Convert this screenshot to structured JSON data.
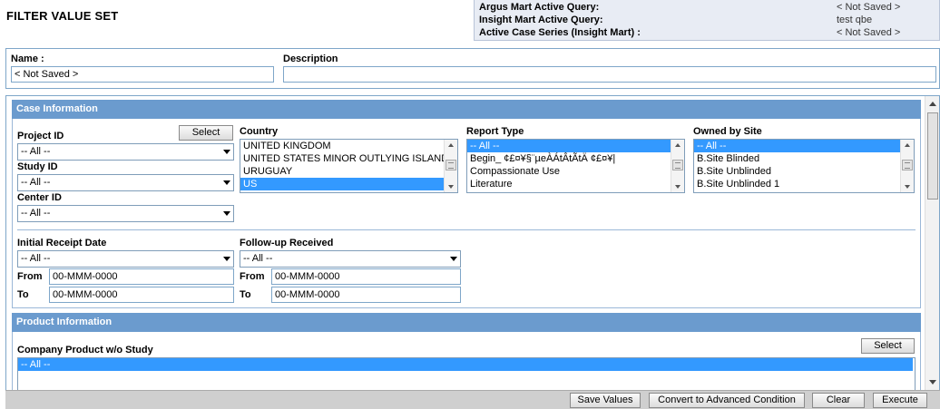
{
  "page_title": "FILTER VALUE SET",
  "active_queries": [
    {
      "label": "Argus Mart Active Query:",
      "value": "< Not Saved >"
    },
    {
      "label": "Insight Mart Active Query:",
      "value": "test qbe"
    },
    {
      "label": "Active Case Series (Insight Mart) :",
      "value": "< Not Saved >"
    }
  ],
  "name_section": {
    "name_label": "Name :",
    "name_value": "< Not Saved >",
    "description_label": "Description",
    "description_value": ""
  },
  "case_info": {
    "header": "Case Information",
    "select_label": "Select",
    "project_id": {
      "label": "Project ID",
      "value": "-- All --"
    },
    "study_id": {
      "label": "Study ID",
      "value": "-- All --"
    },
    "center_id": {
      "label": "Center ID",
      "value": "-- All --"
    },
    "country": {
      "label": "Country",
      "items": [
        "UNITED KINGDOM",
        "UNITED STATES MINOR OUTLYING ISLANDS",
        "URUGUAY",
        "US"
      ],
      "selected_index": 3
    },
    "report_type": {
      "label": "Report Type",
      "items": [
        "-- All --",
        "Begin_ ¢£¤¥§¨µeÀÁtÂtÃtÄ ¢£¤¥|",
        "Compassionate Use",
        "Literature"
      ],
      "selected_index": 0
    },
    "owned_by_site": {
      "label": "Owned by Site",
      "items": [
        "-- All --",
        "B.Site Blinded",
        "B.Site Unblinded",
        "B.Site Unblinded 1"
      ],
      "selected_index": 0
    },
    "initial_receipt": {
      "label": "Initial Receipt Date",
      "value": "-- All --",
      "from_label": "From",
      "from_value": "00-MMM-0000",
      "to_label": "To",
      "to_value": "00-MMM-0000"
    },
    "followup_received": {
      "label": "Follow-up Received",
      "value": "-- All --",
      "from_label": "From",
      "from_value": "00-MMM-0000",
      "to_label": "To",
      "to_value": "00-MMM-0000"
    }
  },
  "product_info": {
    "header": "Product Information",
    "company_product_label": "Company Product w/o Study",
    "select_label": "Select",
    "items": [
      "-- All --"
    ]
  },
  "buttons": {
    "save_values": "Save Values",
    "convert": "Convert to Advanced Condition",
    "clear": "Clear",
    "execute": "Execute"
  },
  "colors": {
    "section_header": "#6b9bce",
    "selection": "#3399ff",
    "panel_border": "#7ea6c9"
  }
}
